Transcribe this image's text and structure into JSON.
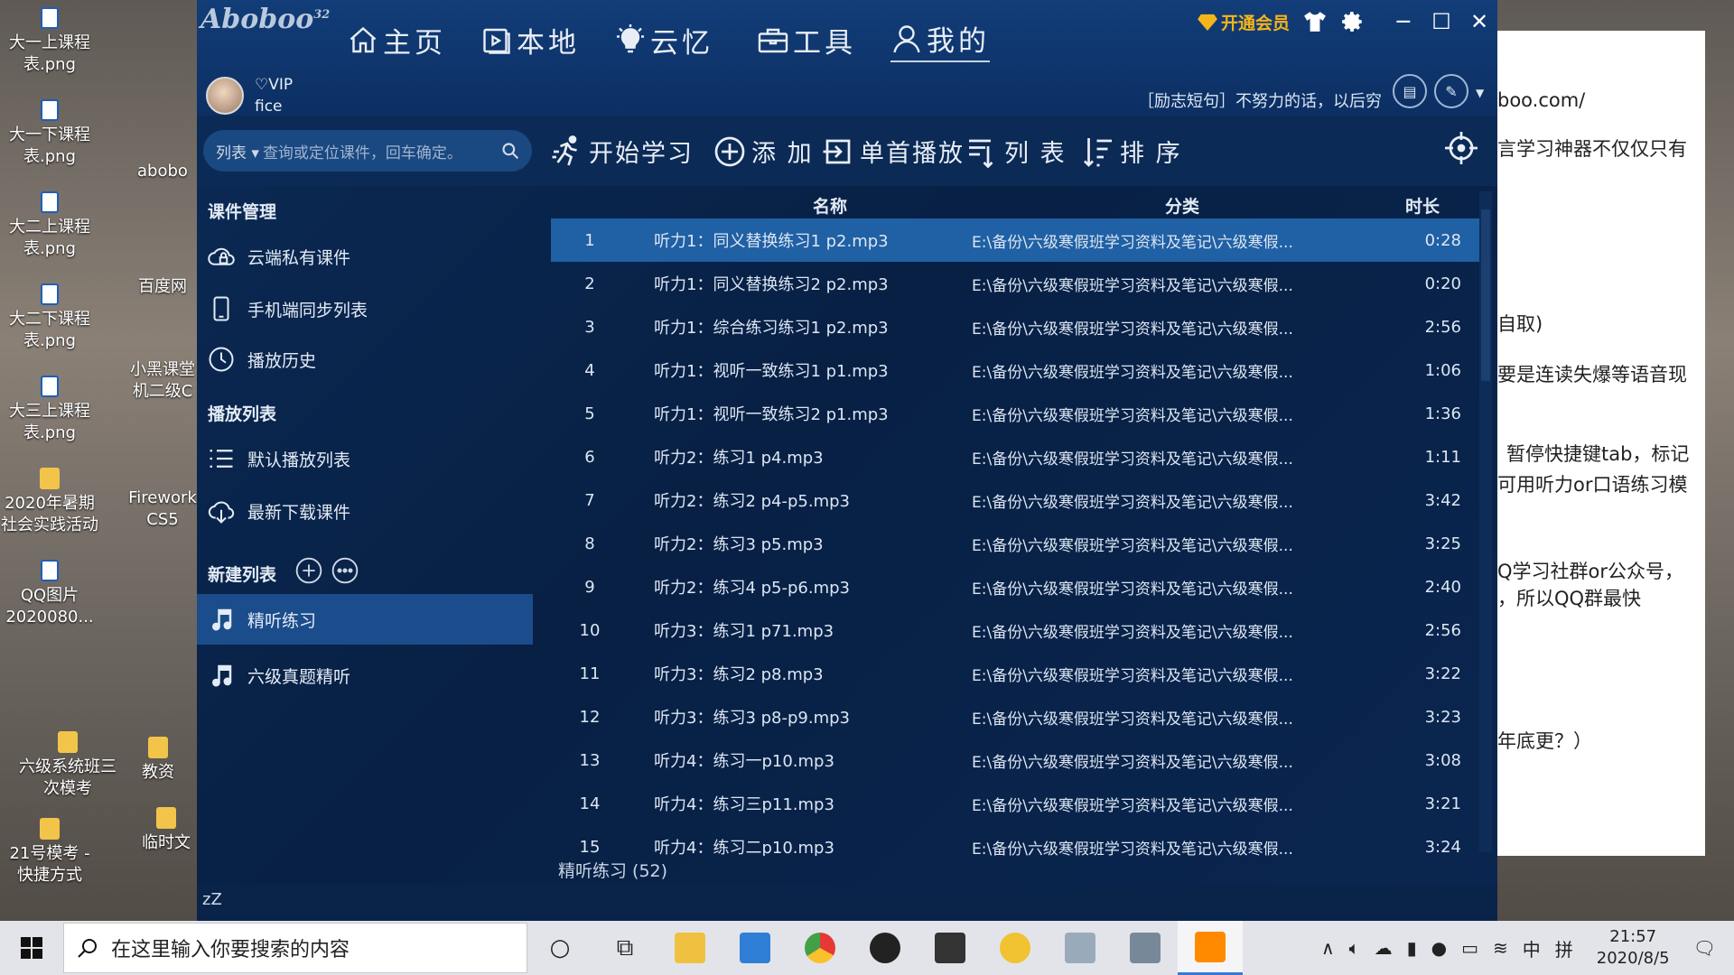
{
  "desktop": {
    "icons": [
      {
        "label": "大一上课程\n表.png",
        "kind": "png"
      },
      {
        "label": "大一下课程\n表.png",
        "kind": "png"
      },
      {
        "label": "大二上课程\n表.png",
        "kind": "png"
      },
      {
        "label": "大二下课程\n表.png",
        "kind": "png"
      },
      {
        "label": "大三上课程\n表.png",
        "kind": "png"
      },
      {
        "label": "2020年暑期\n社会实践活动",
        "kind": "folder"
      },
      {
        "label": "QQ图片\n2020080...",
        "kind": "png"
      },
      {
        "label": "六级系统班三\n次模考",
        "kind": "folder"
      },
      {
        "label": "21号模考 -\n快捷方式",
        "kind": "folder"
      },
      {
        "label": "abobo",
        "kind": "app"
      },
      {
        "label": "百度网",
        "kind": "app"
      },
      {
        "label": "小黑课堂\n机二级C",
        "kind": "app"
      },
      {
        "label": "Firework\nCS5",
        "kind": "app"
      },
      {
        "label": "教资",
        "kind": "folder"
      },
      {
        "label": "临时文",
        "kind": "folder"
      }
    ],
    "notepad_lines": [
      "boo.com/",
      "言学习神器不仅仅只有",
      "自取)",
      "要是连读失爆等语音现",
      "暂停快捷键tab，标记",
      "可用听力or口语练习模",
      "Q学习社群or公众号，",
      "，所以QQ群最快",
      "年底更？）"
    ]
  },
  "app": {
    "logo": "Aboboo",
    "logo_sup": "32",
    "nav": [
      {
        "label": "主页",
        "icon": "home-icon"
      },
      {
        "label": "本地",
        "icon": "local-icon"
      },
      {
        "label": "云忆",
        "icon": "bulb-icon"
      },
      {
        "label": "工具",
        "icon": "toolbox-icon"
      },
      {
        "label": "我的",
        "icon": "user-icon"
      }
    ],
    "vip_button": "开通会员",
    "user": {
      "badge": "♡VIP",
      "name": "fice"
    },
    "motto": "［励志短句］不努力的话，以后穷",
    "search": {
      "scope": "列表",
      "placeholder": "查询或定位课件，回车确定。"
    },
    "toolbar": [
      {
        "label": "开始学习",
        "icon": "run-icon"
      },
      {
        "label": "添 加",
        "icon": "add-icon"
      },
      {
        "label": "单首播放",
        "icon": "single-play-icon"
      },
      {
        "label": "列 表",
        "icon": "list-icon"
      },
      {
        "label": "排 序",
        "icon": "sort-icon"
      }
    ],
    "sidebar": {
      "sec1": "课件管理",
      "sec1_items": [
        "云端私有课件",
        "手机端同步列表",
        "播放历史"
      ],
      "sec2": "播放列表",
      "sec2_items": [
        "默认播放列表",
        "最新下载课件"
      ],
      "sec3": "新建列表",
      "playlists": [
        "精听练习",
        "六级真题精听"
      ]
    },
    "table": {
      "headers": {
        "name": "名称",
        "category": "分类",
        "duration": "时长"
      },
      "rows": [
        {
          "n": "1",
          "name": "听力1：同义替换练习1 p2.mp3",
          "cat": "E:\\备份\\六级寒假班学习资料及笔记\\六级寒假...",
          "dur": "0:28"
        },
        {
          "n": "2",
          "name": "听力1：同义替换练习2 p2.mp3",
          "cat": "E:\\备份\\六级寒假班学习资料及笔记\\六级寒假...",
          "dur": "0:20"
        },
        {
          "n": "3",
          "name": "听力1：综合练习练习1 p2.mp3",
          "cat": "E:\\备份\\六级寒假班学习资料及笔记\\六级寒假...",
          "dur": "2:56"
        },
        {
          "n": "4",
          "name": "听力1：视听一致练习1 p1.mp3",
          "cat": "E:\\备份\\六级寒假班学习资料及笔记\\六级寒假...",
          "dur": "1:06"
        },
        {
          "n": "5",
          "name": "听力1：视听一致练习2 p1.mp3",
          "cat": "E:\\备份\\六级寒假班学习资料及笔记\\六级寒假...",
          "dur": "1:36"
        },
        {
          "n": "6",
          "name": "听力2：练习1 p4.mp3",
          "cat": "E:\\备份\\六级寒假班学习资料及笔记\\六级寒假...",
          "dur": "1:11"
        },
        {
          "n": "7",
          "name": "听力2：练习2 p4-p5.mp3",
          "cat": "E:\\备份\\六级寒假班学习资料及笔记\\六级寒假...",
          "dur": "3:42"
        },
        {
          "n": "8",
          "name": "听力2：练习3 p5.mp3",
          "cat": "E:\\备份\\六级寒假班学习资料及笔记\\六级寒假...",
          "dur": "3:25"
        },
        {
          "n": "9",
          "name": "听力2：练习4 p5-p6.mp3",
          "cat": "E:\\备份\\六级寒假班学习资料及笔记\\六级寒假...",
          "dur": "2:40"
        },
        {
          "n": "10",
          "name": "听力3：练习1 p71.mp3",
          "cat": "E:\\备份\\六级寒假班学习资料及笔记\\六级寒假...",
          "dur": "2:56"
        },
        {
          "n": "11",
          "name": "听力3：练习2 p8.mp3",
          "cat": "E:\\备份\\六级寒假班学习资料及笔记\\六级寒假...",
          "dur": "3:22"
        },
        {
          "n": "12",
          "name": "听力3：练习3 p8-p9.mp3",
          "cat": "E:\\备份\\六级寒假班学习资料及笔记\\六级寒假...",
          "dur": "3:23"
        },
        {
          "n": "13",
          "name": "听力4：练习一p10.mp3",
          "cat": "E:\\备份\\六级寒假班学习资料及笔记\\六级寒假...",
          "dur": "3:08"
        },
        {
          "n": "14",
          "name": "听力4：练习三p11.mp3",
          "cat": "E:\\备份\\六级寒假班学习资料及笔记\\六级寒假...",
          "dur": "3:21"
        },
        {
          "n": "15",
          "name": "听力4：练习二p10.mp3",
          "cat": "E:\\备份\\六级寒假班学习资料及笔记\\六级寒假...",
          "dur": "3:24"
        }
      ]
    },
    "footer": "精听练习 (52)",
    "status": "zZ"
  },
  "taskbar": {
    "search_placeholder": "在这里输入你要搜索的内容",
    "ime": "中",
    "ime2": "拼",
    "time": "21:57",
    "date": "2020/8/5"
  },
  "colors": {
    "accent": "#2060a4",
    "vip": "#f5b41a",
    "app_bg": "#0b2a55"
  }
}
